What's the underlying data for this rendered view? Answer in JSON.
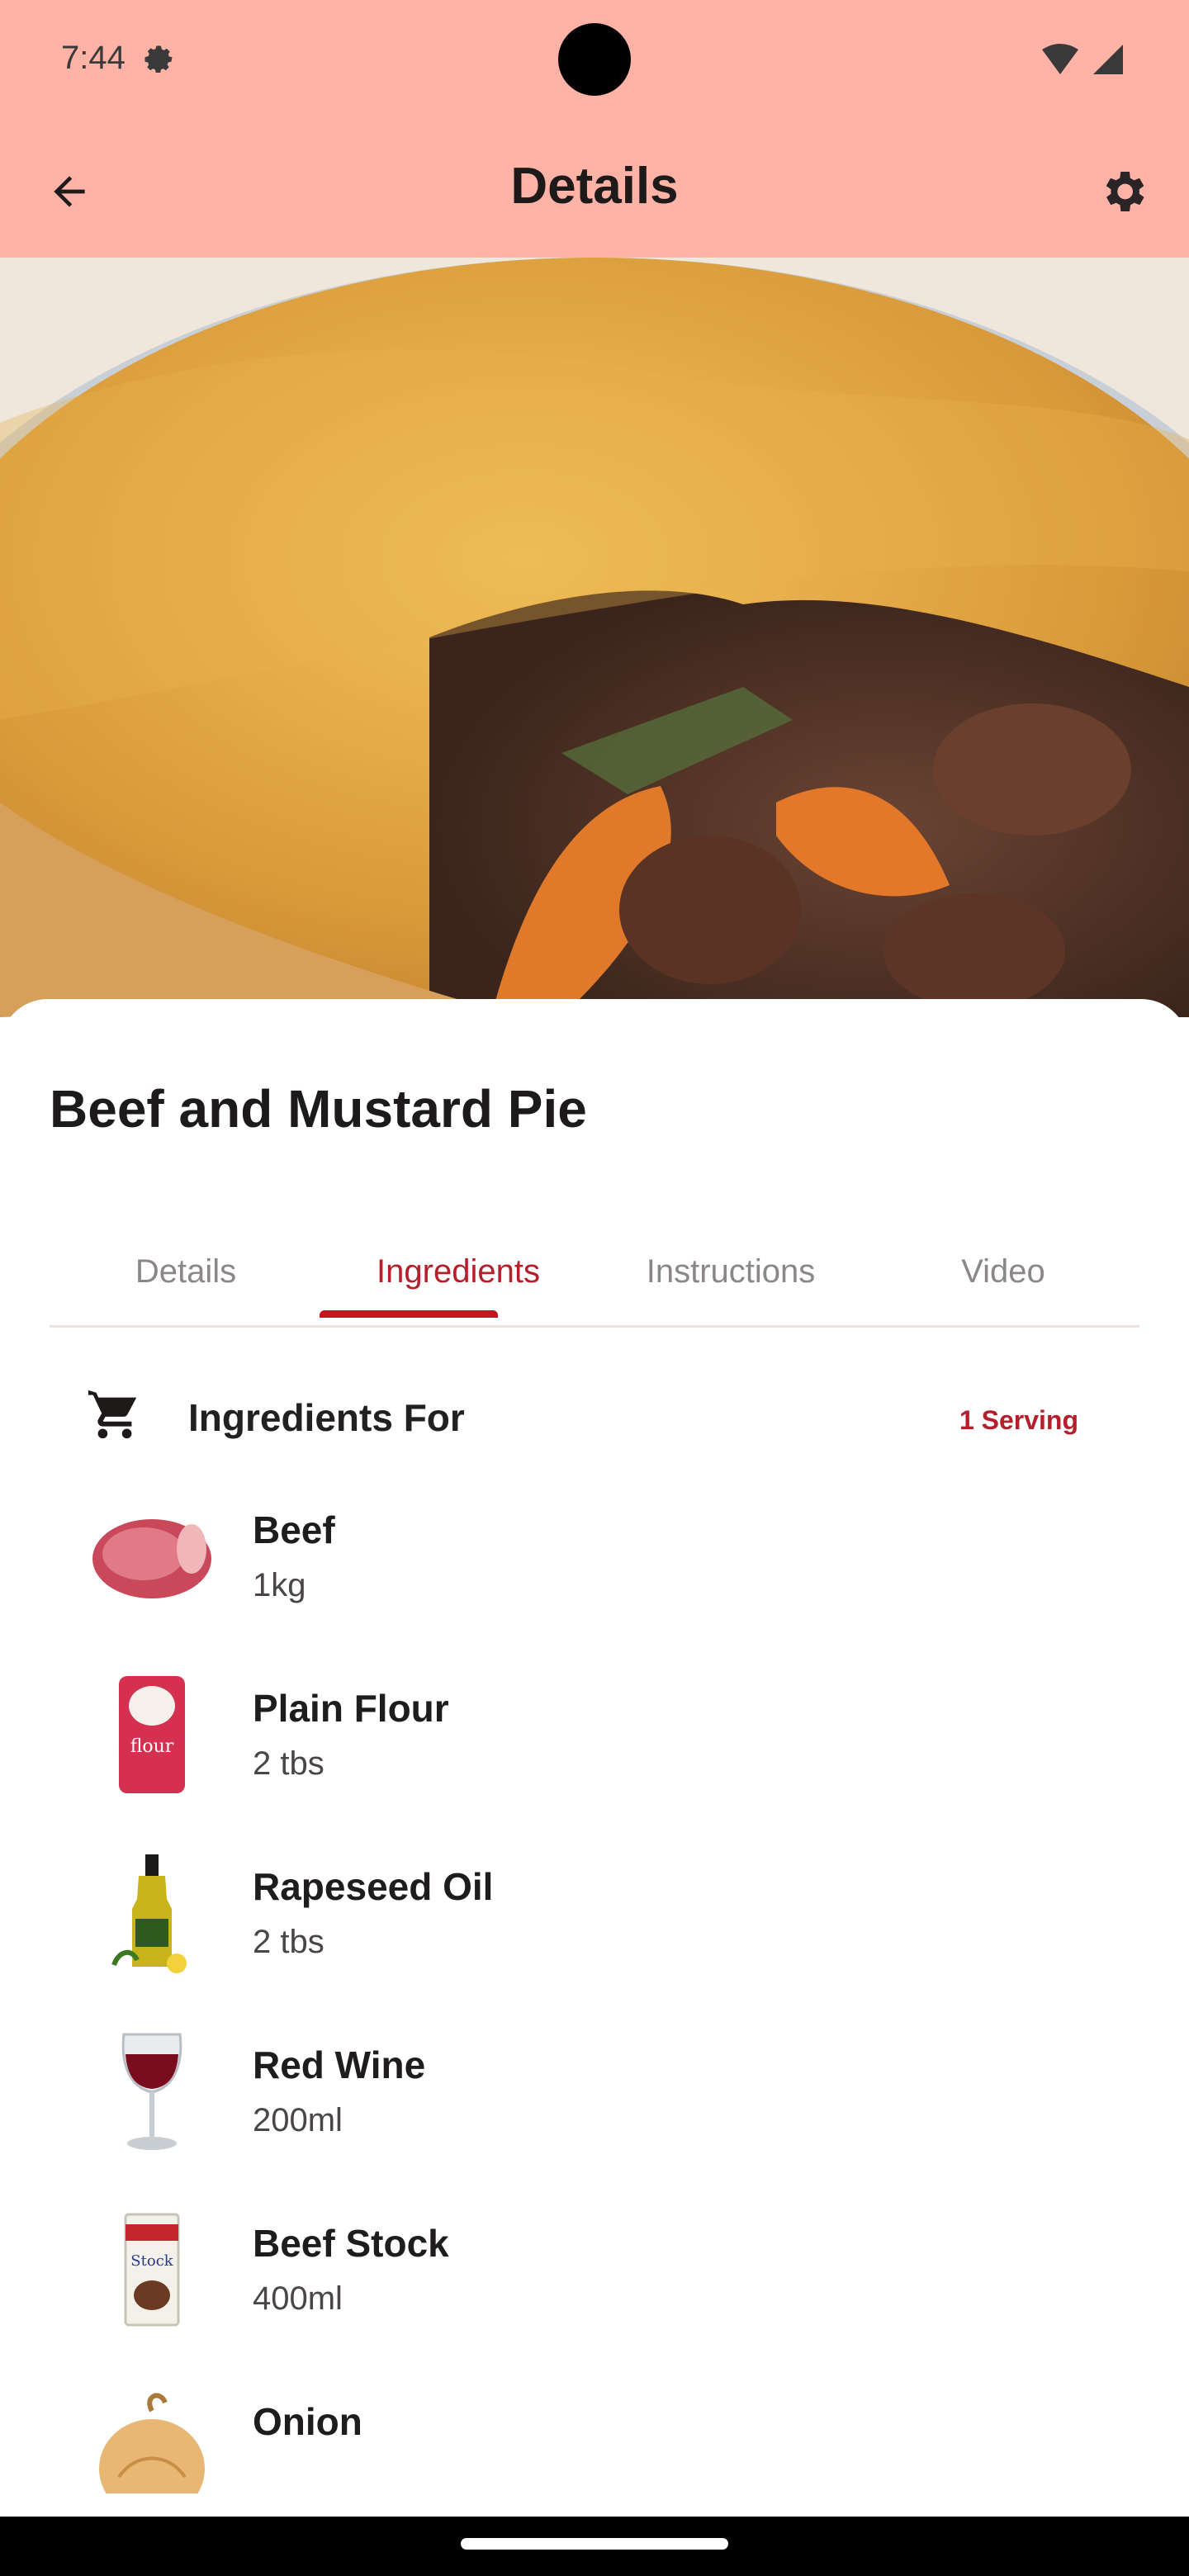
{
  "status": {
    "time": "7:44"
  },
  "appbar": {
    "title": "Details"
  },
  "recipe": {
    "title": "Beef and Mustard Pie"
  },
  "tabs": [
    {
      "label": "Details",
      "active": false
    },
    {
      "label": "Ingredients",
      "active": true
    },
    {
      "label": "Instructions",
      "active": false
    },
    {
      "label": "Video",
      "active": false
    }
  ],
  "ingredients_header": {
    "label": "Ingredients For",
    "serving": "1 Serving"
  },
  "ingredients": [
    {
      "name": "Beef",
      "qty": "1kg",
      "icon": "beef-icon"
    },
    {
      "name": "Plain Flour",
      "qty": "2 tbs",
      "icon": "flour-icon"
    },
    {
      "name": "Rapeseed Oil",
      "qty": "2 tbs",
      "icon": "oil-icon"
    },
    {
      "name": "Red Wine",
      "qty": "200ml",
      "icon": "wine-icon"
    },
    {
      "name": "Beef Stock",
      "qty": "400ml",
      "icon": "stock-icon"
    },
    {
      "name": "Onion",
      "qty": "",
      "icon": "onion-icon"
    }
  ],
  "colors": {
    "appbar": "#ffb3a7",
    "accent": "#b3202b"
  }
}
